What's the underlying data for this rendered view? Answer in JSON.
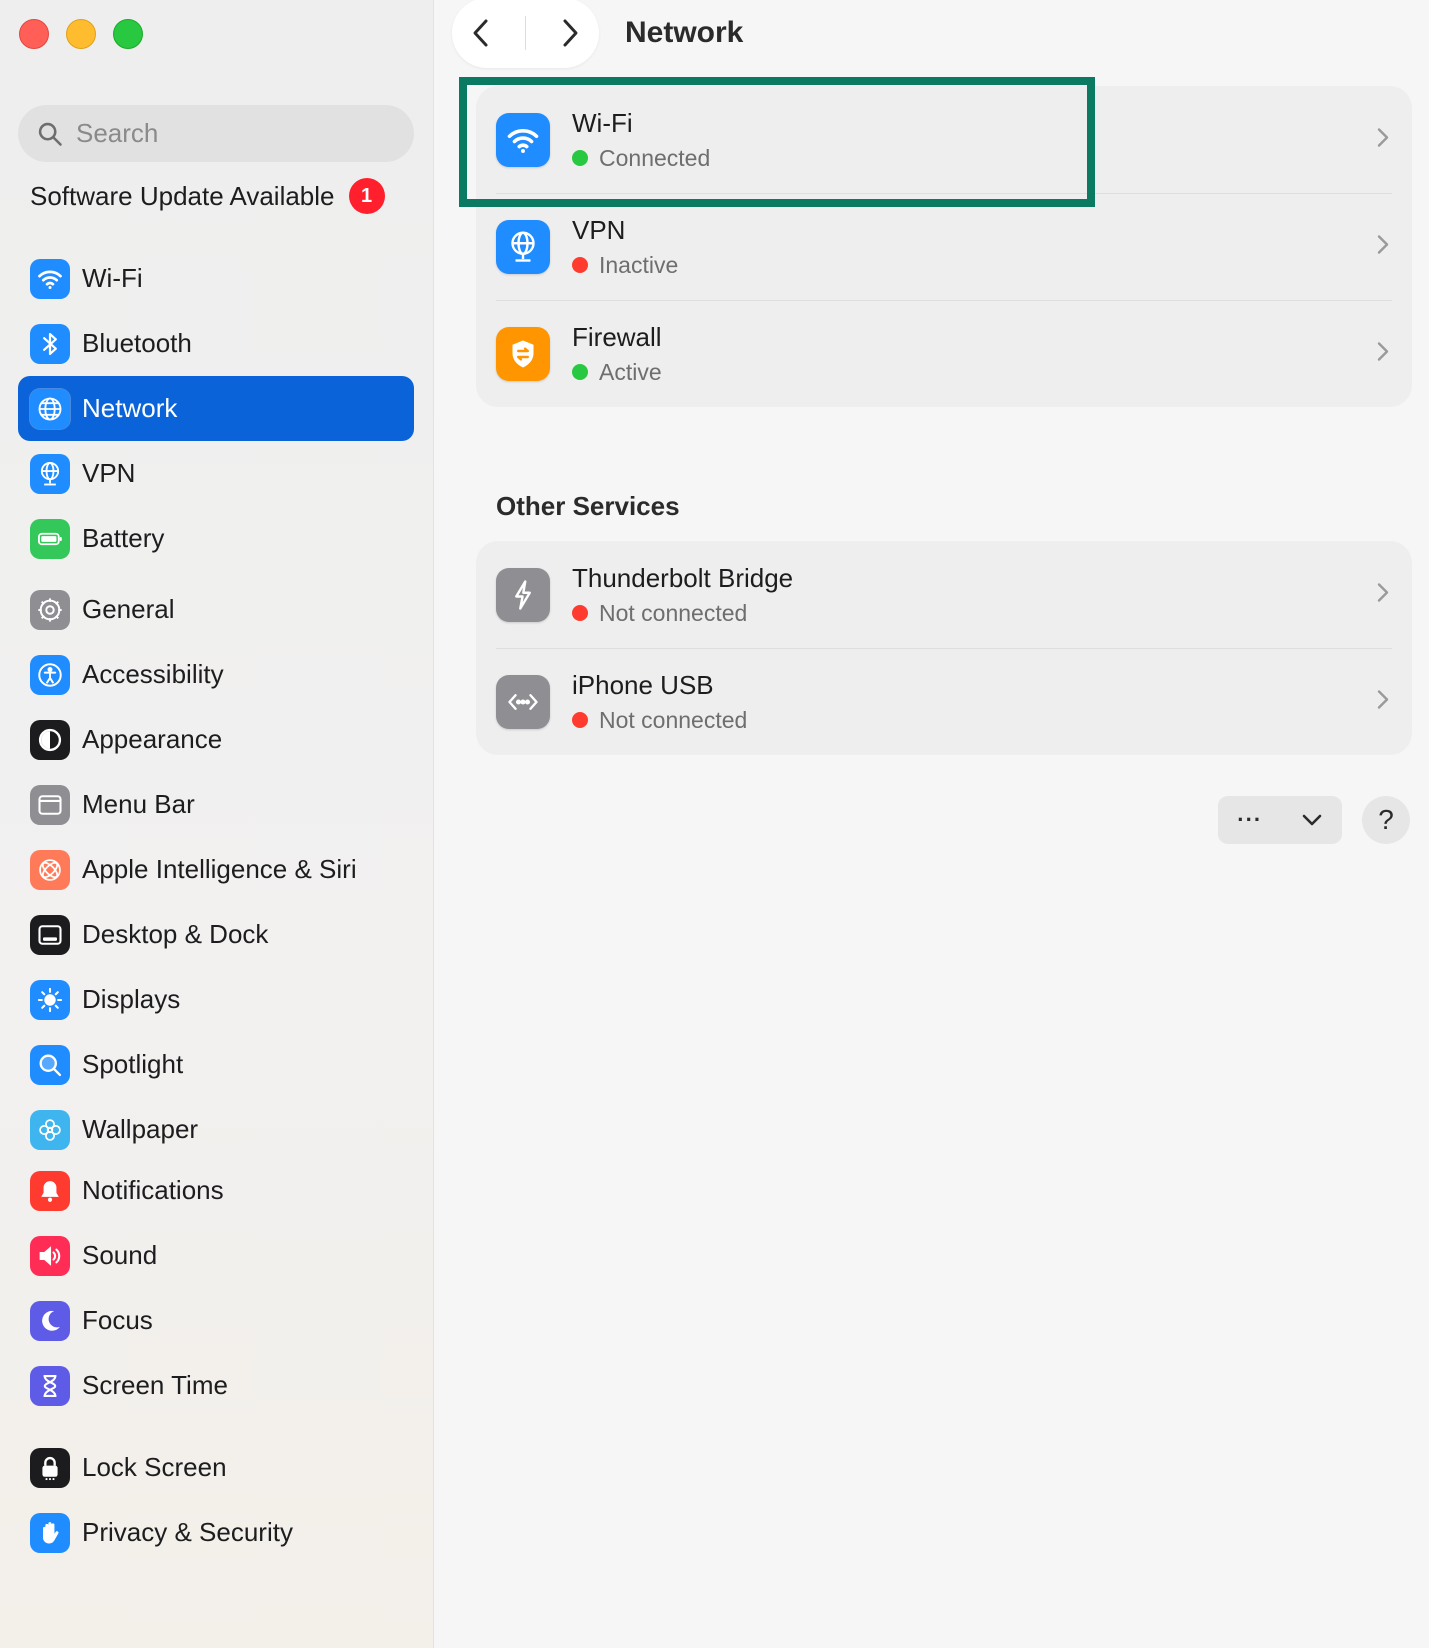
{
  "window": {
    "title": "Network"
  },
  "search": {
    "placeholder": "Search"
  },
  "update": {
    "label": "Software Update Available",
    "badge": "1"
  },
  "sidebar": {
    "groups": [
      [
        {
          "label": "Wi-Fi",
          "icon": "wifi-icon",
          "color": "#1f8cff"
        },
        {
          "label": "Bluetooth",
          "icon": "bluetooth-icon",
          "color": "#1f8cff"
        },
        {
          "label": "Network",
          "icon": "globe-icon",
          "color": "#1f8cff",
          "selected": true
        },
        {
          "label": "VPN",
          "icon": "vpn-globe-icon",
          "color": "#1f8cff"
        },
        {
          "label": "Battery",
          "icon": "battery-icon",
          "color": "#34c759"
        }
      ],
      [
        {
          "label": "General",
          "icon": "gear-icon",
          "color": "#8e8e93"
        },
        {
          "label": "Accessibility",
          "icon": "accessibility-icon",
          "color": "#1f8cff"
        },
        {
          "label": "Appearance",
          "icon": "appearance-icon",
          "color": "#1c1c1e"
        },
        {
          "label": "Menu Bar",
          "icon": "menu-bar-icon",
          "color": "#8e8e93"
        },
        {
          "label": "Apple Intelligence & Siri",
          "icon": "siri-icon",
          "color": "#ff7a59"
        },
        {
          "label": "Desktop & Dock",
          "icon": "dock-icon",
          "color": "#1c1c1e"
        },
        {
          "label": "Displays",
          "icon": "sun-icon",
          "color": "#1f8cff"
        },
        {
          "label": "Spotlight",
          "icon": "magnifier-icon",
          "color": "#1f8cff"
        },
        {
          "label": "Wallpaper",
          "icon": "flower-icon",
          "color": "#3fb5f0"
        }
      ],
      [
        {
          "label": "Notifications",
          "icon": "bell-icon",
          "color": "#ff3b30"
        },
        {
          "label": "Sound",
          "icon": "speaker-icon",
          "color": "#ff2d55"
        },
        {
          "label": "Focus",
          "icon": "moon-icon",
          "color": "#5e5ce6"
        },
        {
          "label": "Screen Time",
          "icon": "hourglass-icon",
          "color": "#5e5ce6"
        }
      ],
      [
        {
          "label": "Lock Screen",
          "icon": "lock-icon",
          "color": "#1c1c1e"
        },
        {
          "label": "Privacy & Security",
          "icon": "hand-icon",
          "color": "#1f8cff"
        }
      ]
    ]
  },
  "main": {
    "primary": [
      {
        "title": "Wi-Fi",
        "status": "Connected",
        "status_color": "green",
        "icon": "wifi-icon",
        "color": "#1f8cff"
      },
      {
        "title": "VPN",
        "status": "Inactive",
        "status_color": "red",
        "icon": "vpn-globe-icon",
        "color": "#1f8cff"
      },
      {
        "title": "Firewall",
        "status": "Active",
        "status_color": "green",
        "icon": "firewall-shield-icon",
        "color": "#ff9500"
      }
    ],
    "other_title": "Other Services",
    "other": [
      {
        "title": "Thunderbolt Bridge",
        "status": "Not connected",
        "status_color": "red",
        "icon": "thunderbolt-icon",
        "color": "#8e8e93"
      },
      {
        "title": "iPhone USB",
        "status": "Not connected",
        "status_color": "red",
        "icon": "usb-icon",
        "color": "#8e8e93"
      }
    ],
    "actions": {
      "more": "···",
      "help": "?"
    }
  }
}
